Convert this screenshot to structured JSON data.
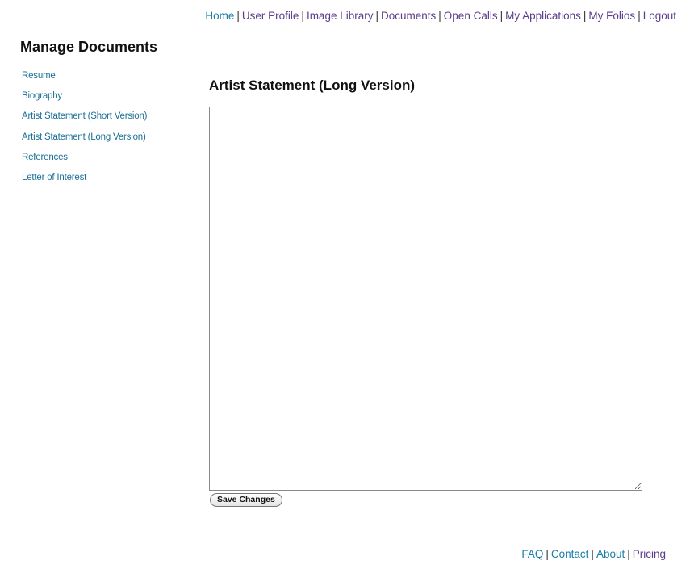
{
  "top_nav": {
    "items": [
      {
        "label": "Home",
        "color": "#1a7fa6"
      },
      {
        "label": "User Profile",
        "color": "#5a3d8a"
      },
      {
        "label": "Image Library",
        "color": "#5a3d8a"
      },
      {
        "label": "Documents",
        "color": "#5a3d8a"
      },
      {
        "label": "Open Calls",
        "color": "#5a3d8a"
      },
      {
        "label": "My Applications",
        "color": "#5a3d8a"
      },
      {
        "label": "My Folios",
        "color": "#5a3d8a"
      },
      {
        "label": "Logout",
        "color": "#5a3d8a"
      }
    ],
    "separator": "|"
  },
  "sidebar": {
    "title": "Manage Documents",
    "items": [
      {
        "label": "Resume"
      },
      {
        "label": "Biography"
      },
      {
        "label": "Artist Statement (Short Version)"
      },
      {
        "label": "Artist Statement (Long Version)"
      },
      {
        "label": "References"
      },
      {
        "label": "Letter of Interest"
      }
    ]
  },
  "main": {
    "title": "Artist Statement (Long Version)",
    "editor_value": "",
    "save_label": "Save Changes"
  },
  "footer_nav": {
    "items": [
      {
        "label": "FAQ"
      },
      {
        "label": "Contact"
      },
      {
        "label": "About"
      },
      {
        "label": "Pricing"
      }
    ],
    "separator": "|"
  }
}
